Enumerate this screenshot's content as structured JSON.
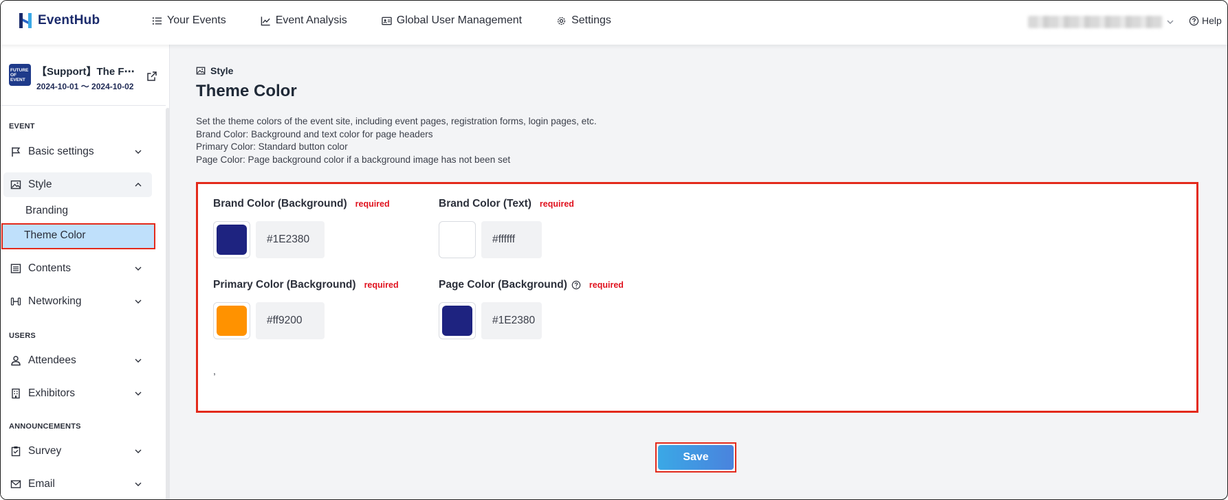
{
  "app": {
    "name": "EventHub"
  },
  "topnav": [
    {
      "label": "Your Events",
      "icon": "list-icon"
    },
    {
      "label": "Event Analysis",
      "icon": "chart-icon"
    },
    {
      "label": "Global User Management",
      "icon": "id-card-icon"
    },
    {
      "label": "Settings",
      "icon": "gear-icon"
    }
  ],
  "help_label": "Help",
  "event": {
    "title": "【Support】The F⋯",
    "dates": "2024-10-01 ～ 2024-10-02",
    "thumb_text": "FUTURE OF EVENT"
  },
  "sidebar": {
    "sections": {
      "event": "EVENT",
      "users": "USERS",
      "announcements": "ANNOUNCEMENTS"
    },
    "items": {
      "basic_settings": "Basic settings",
      "style": "Style",
      "branding": "Branding",
      "theme_color": "Theme Color",
      "contents": "Contents",
      "networking": "Networking",
      "attendees": "Attendees",
      "exhibitors": "Exhibitors",
      "survey": "Survey",
      "email": "Email"
    }
  },
  "page": {
    "crumb": "Style",
    "title": "Theme Color",
    "description": [
      "Set the theme colors of the event site, including event pages, registration forms, login pages, etc.",
      "Brand Color: Background and text color for page headers",
      "Primary Color: Standard button color",
      "Page Color: Page background color if a background image has not been set"
    ]
  },
  "fields": {
    "brand_bg": {
      "label": "Brand Color (Background)",
      "required": "required",
      "value": "#1E2380",
      "color": "#1E2380"
    },
    "brand_text": {
      "label": "Brand Color (Text)",
      "required": "required",
      "value": "#ffffff",
      "color": "#ffffff"
    },
    "primary_bg": {
      "label": "Primary Color (Background)",
      "required": "required",
      "value": "#ff9200",
      "color": "#ff9200"
    },
    "page_bg": {
      "label": "Page Color (Background)",
      "required": "required",
      "value": "#1E2380",
      "color": "#1E2380"
    }
  },
  "stray_text": ",",
  "save_label": "Save"
}
